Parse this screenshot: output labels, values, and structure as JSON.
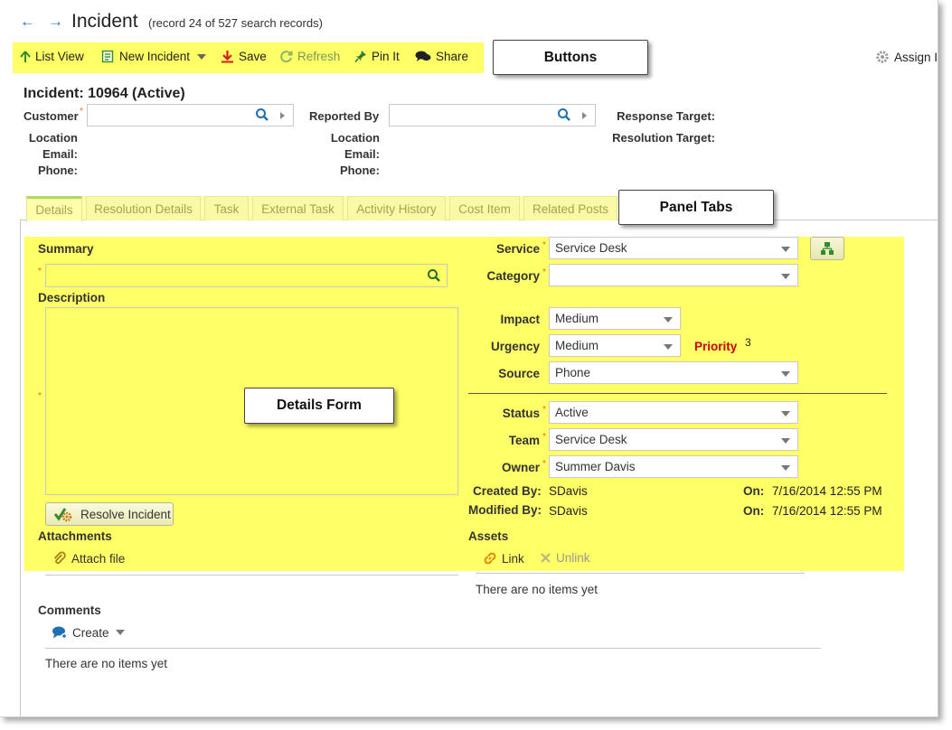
{
  "header": {
    "title": "Incident",
    "subtitle": "(record 24 of 527 search records)"
  },
  "toolbar": {
    "list_view": "List View",
    "new_incident": "New Incident",
    "save": "Save",
    "refresh": "Refresh",
    "pin_it": "Pin It",
    "share": "Share",
    "assign": "Assign I"
  },
  "callouts": {
    "buttons": "Buttons",
    "panel_tabs": "Panel Tabs",
    "details_form": "Details Form"
  },
  "record": {
    "heading": "Incident: 10964 (Active)",
    "customer_label": "Customer",
    "reported_by_label": "Reported By",
    "location_label": "Location",
    "email_label": "Email:",
    "phone_label": "Phone:",
    "response_target_label": "Response Target:",
    "resolution_target_label": "Resolution Target:",
    "required_marker": "*"
  },
  "tabs": [
    "Details",
    "Resolution Details",
    "Task",
    "External Task",
    "Activity History",
    "Cost Item",
    "Related Posts"
  ],
  "details": {
    "summary_label": "Summary",
    "description_label": "Description",
    "resolve_button": "Resolve Incident",
    "attachments_label": "Attachments",
    "attach_file": "Attach file",
    "service_label": "Service",
    "service_value": "Service Desk",
    "category_label": "Category",
    "category_value": "",
    "impact_label": "Impact",
    "impact_value": "Medium",
    "urgency_label": "Urgency",
    "urgency_value": "Medium",
    "priority_label": "Priority",
    "priority_value": "3",
    "source_label": "Source",
    "source_value": "Phone",
    "status_label": "Status",
    "status_value": "Active",
    "team_label": "Team",
    "team_value": "Service Desk",
    "owner_label": "Owner",
    "owner_value": "Summer Davis",
    "created_by_label": "Created By:",
    "created_by_value": "SDavis",
    "modified_by_label": "Modified By:",
    "modified_by_value": "SDavis",
    "on_label": "On:",
    "created_on": "7/16/2014 12:55 PM",
    "modified_on": "7/16/2014 12:55 PM",
    "assets_label": "Assets",
    "link": "Link",
    "unlink": "Unlink",
    "assets_empty": "There are no items yet"
  },
  "comments": {
    "label": "Comments",
    "create": "Create",
    "empty": "There are no items yet"
  },
  "colors": {
    "highlight": "#ffff66",
    "accent_blue": "#1f6fb5",
    "priority_red": "#cc0000",
    "required_orange": "#e06a2c",
    "tab_active_green": "#4caf50"
  }
}
